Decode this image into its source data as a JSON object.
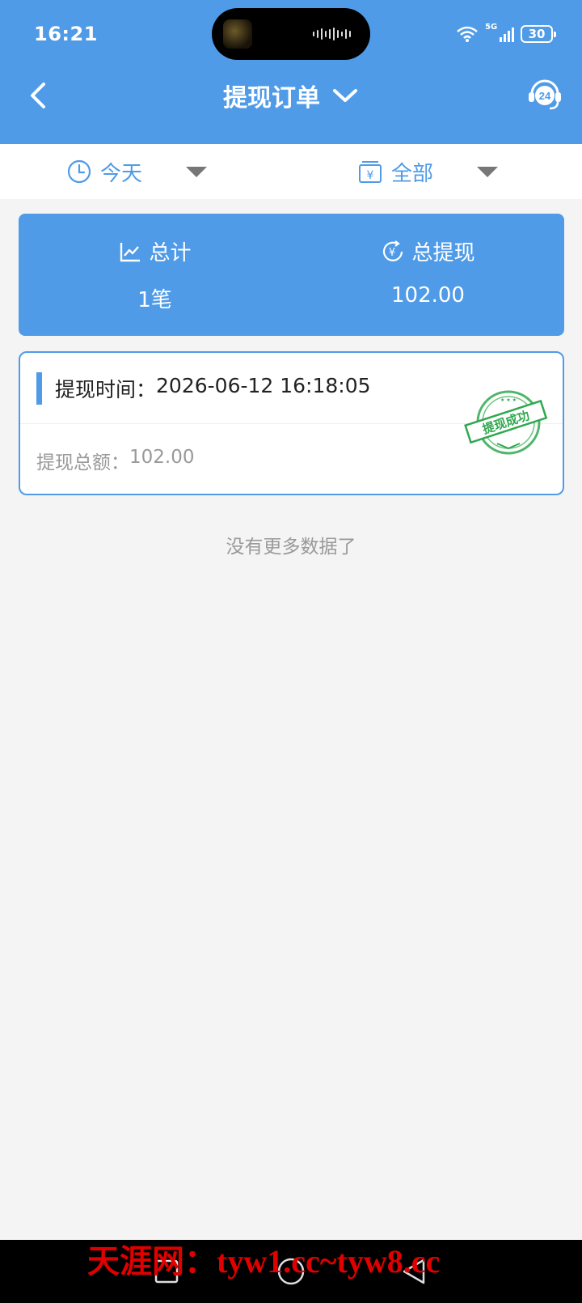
{
  "status_bar": {
    "time": "16:21",
    "network": "5G",
    "battery": "30",
    "icons": [
      "wifi-icon",
      "signal-icon",
      "battery-icon"
    ]
  },
  "nav": {
    "title": "提现订单",
    "back_icon": "chevron-left-icon",
    "title_icon": "chevron-down-icon",
    "support_icon": "support-24h-icon",
    "support_label": "24"
  },
  "filters": {
    "date": {
      "label": "今天",
      "icon": "clock-icon"
    },
    "type": {
      "label": "全部",
      "icon": "wallet-icon"
    }
  },
  "summary": {
    "total_label": "总计",
    "total_value": "1笔",
    "withdraw_label": "总提现",
    "withdraw_value": "102.00"
  },
  "orders": [
    {
      "time_label": "提现时间：",
      "time_value": "2026-06-12 16:18:05",
      "amount_label": "提现总额：",
      "amount_value": "102.00",
      "stamp_text": "提现成功"
    }
  ],
  "no_more_text": "没有更多数据了",
  "watermark": "天涯网：tyw1.cc~tyw8.cc",
  "colors": {
    "primary": "#4f9be8",
    "stamp_green": "#2fa84f",
    "watermark_red": "#e00000"
  }
}
